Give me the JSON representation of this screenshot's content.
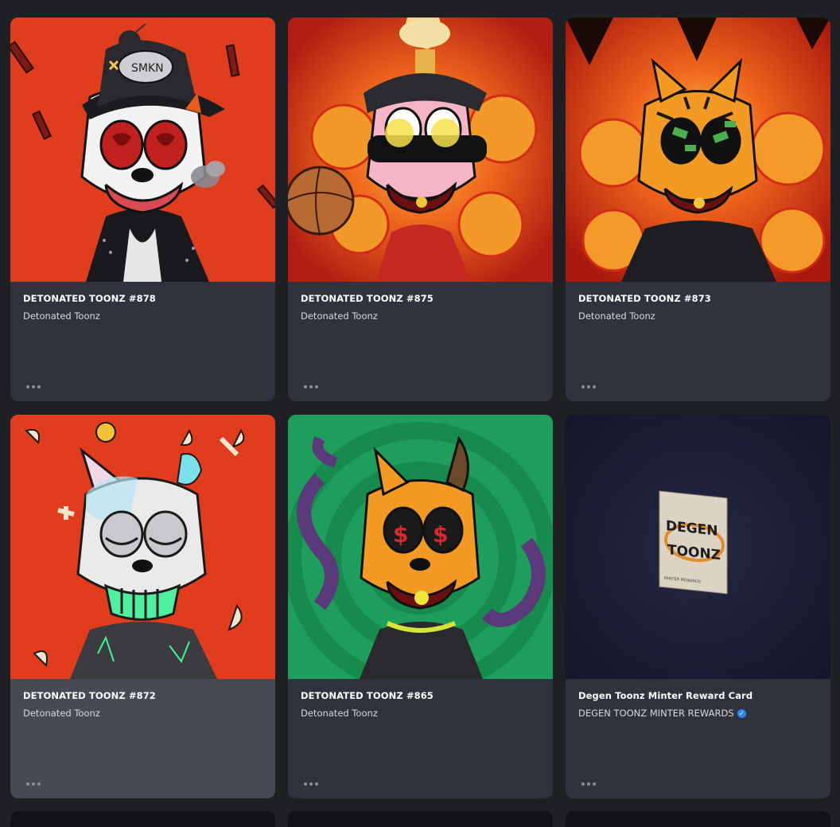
{
  "cards": [
    {
      "title": "DETONATED TOONZ #878",
      "collection": "Detonated Toonz",
      "verified": false,
      "art_bg": "#e03d1e"
    },
    {
      "title": "DETONATED TOONZ #875",
      "collection": "Detonated Toonz",
      "verified": false,
      "art_bg": "#d8341a"
    },
    {
      "title": "DETONATED TOONZ #873",
      "collection": "Detonated Toonz",
      "verified": false,
      "art_bg": "#d9381b"
    },
    {
      "title": "DETONATED TOONZ #872",
      "collection": "Detonated Toonz",
      "verified": false,
      "art_bg": "#e23c1f"
    },
    {
      "title": "DETONATED TOONZ #865",
      "collection": "Detonated Toonz",
      "verified": false,
      "art_bg": "#1f9d5c"
    },
    {
      "title": "Degen Toonz Minter Reward Card",
      "collection": "DEGEN TOONZ MINTER REWARDS",
      "verified": true,
      "art_bg": "#1b1e2e"
    }
  ],
  "more_icon": "ellipsis-icon",
  "verified_icon": "verified-check-icon",
  "reward_card": {
    "line1": "DEGEN",
    "line2": "TOONZ",
    "footer": "MINTER REWARDS"
  }
}
